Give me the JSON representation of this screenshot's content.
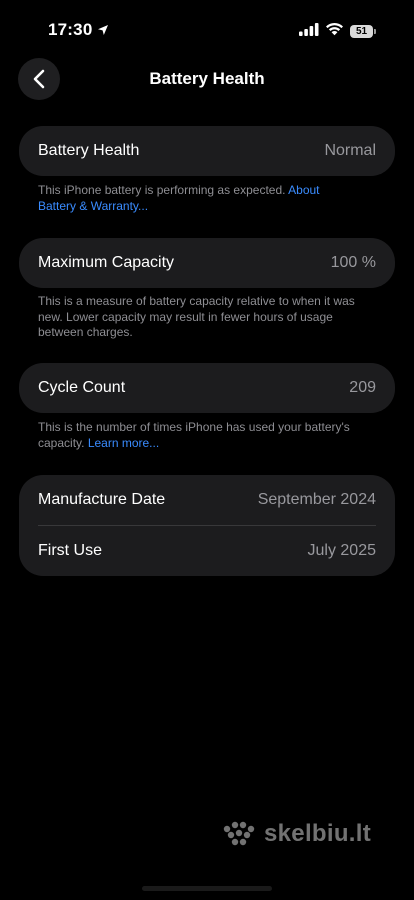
{
  "status_bar": {
    "time": "17:30",
    "battery_level": "51",
    "icons": [
      "location-arrow-icon",
      "cellular-signal-icon",
      "wifi-icon",
      "battery-icon"
    ]
  },
  "nav": {
    "title": "Battery Health",
    "back_icon": "chevron-left-icon"
  },
  "sections": {
    "health": {
      "label": "Battery Health",
      "value": "Normal",
      "footnote": "This iPhone battery is performing as expected.",
      "footnote_link": "About Battery & Warranty..."
    },
    "capacity": {
      "label": "Maximum Capacity",
      "value": "100 %",
      "footnote": "This is a measure of battery capacity relative to when it was new. Lower capacity may result in fewer hours of usage between charges."
    },
    "cycles": {
      "label": "Cycle Count",
      "value": "209",
      "footnote": "This is the number of times iPhone has used your battery's capacity.",
      "footnote_link": "Learn more..."
    },
    "dates": {
      "manufacture_label": "Manufacture Date",
      "manufacture_value": "September 2024",
      "first_use_label": "First Use",
      "first_use_value": "July 2025"
    }
  },
  "watermark": {
    "text": "skelbiu.lt"
  },
  "colors": {
    "background": "#000000",
    "card": "#1c1c1e",
    "secondary_text": "#98989d",
    "footnote_text": "#8e8e93",
    "link": "#3a8cff"
  }
}
